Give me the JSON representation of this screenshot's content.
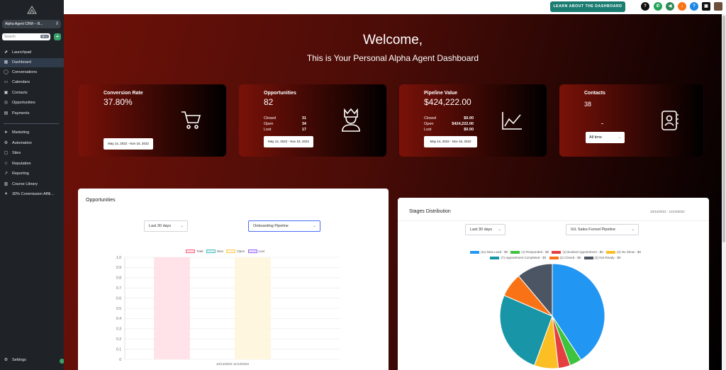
{
  "sidebar": {
    "account": "Alpha Agent CRM -- B...",
    "search_placeholder": "Search",
    "search_shortcut": "⌘ K",
    "add_label": "+",
    "items": [
      {
        "label": "Launchpad",
        "icon": "rocket-icon"
      },
      {
        "label": "Dashboard",
        "icon": "dashboard-icon"
      },
      {
        "label": "Conversations",
        "icon": "chat-icon"
      },
      {
        "label": "Calendars",
        "icon": "calendar-icon"
      },
      {
        "label": "Contacts",
        "icon": "contacts-icon"
      },
      {
        "label": "Opportunities",
        "icon": "opportunities-icon"
      },
      {
        "label": "Payments",
        "icon": "payments-icon"
      }
    ],
    "items2": [
      {
        "label": "Marketing",
        "icon": "send-icon"
      },
      {
        "label": "Automation",
        "icon": "automation-icon"
      },
      {
        "label": "Sites",
        "icon": "sites-icon"
      },
      {
        "label": "Reputation",
        "icon": "star-icon"
      },
      {
        "label": "Reporting",
        "icon": "chart-icon"
      },
      {
        "label": "Course Library",
        "icon": "book-icon"
      },
      {
        "label": "30% Commission Affili...",
        "icon": "gift-icon"
      }
    ],
    "settings": "Settings",
    "active": "Dashboard"
  },
  "topbar": {
    "learn_button": "LEARN ABOUT THE DASHBOARD",
    "icons": [
      "help-icon",
      "phone-icon",
      "megaphone-icon",
      "bell-icon",
      "question-icon",
      "contact-card-icon",
      "avatar"
    ]
  },
  "hero": {
    "title": "Welcome,",
    "subtitle": "This is Your Personal Alpha Agent Dashboard"
  },
  "cards": {
    "conversion": {
      "label": "Conversion Rate",
      "value": "37.80%",
      "date": "May 14, 2022 - Nov 15, 2022"
    },
    "opportunities": {
      "label": "Opportunities",
      "value": "82",
      "rows": [
        {
          "k": "Closed",
          "v": "31"
        },
        {
          "k": "Open",
          "v": "34"
        },
        {
          "k": "Lost",
          "v": "17"
        }
      ],
      "date": "May 14, 2022 - Nov 15, 2022"
    },
    "pipeline": {
      "label": "Pipeline Value",
      "value": "$424,222.00",
      "rows": [
        {
          "k": "Closed",
          "v": "$0.00"
        },
        {
          "k": "Open",
          "v": "$424,222.00"
        },
        {
          "k": "Lost",
          "v": "$0.00"
        }
      ],
      "date": "May 14, 2022 - Nov 15, 2022"
    },
    "contacts": {
      "label": "Contacts",
      "value": "38",
      "filter": "All time"
    }
  },
  "opportunities_panel": {
    "title": "Opportunities",
    "range": "Last 30 days",
    "pipeline": "Onboarding Pipeline",
    "chart_data": {
      "type": "bar",
      "categories": [
        "10/14/2022-11/13/2022"
      ],
      "series": [
        {
          "name": "Total",
          "values": [
            0
          ],
          "color": "#ff6384"
        },
        {
          "name": "Won",
          "values": [
            0
          ],
          "color": "#4bc0c0"
        },
        {
          "name": "Open",
          "values": [
            0
          ],
          "color": "#ffcd56"
        },
        {
          "name": "Lost",
          "values": [
            0
          ],
          "color": "#9966ff"
        }
      ],
      "ylim": [
        0,
        1.0
      ],
      "yticks": [
        "1.0",
        "0.9",
        "0.8",
        "0.7",
        "0.6",
        "0.5",
        "0.4",
        "0.3",
        "0.2",
        "0.1",
        "0"
      ],
      "legend": "top"
    }
  },
  "stages_panel": {
    "title": "Stages Distribution",
    "date_range": "10/13/2022 - 11/13/2022",
    "range": "Last 30 days",
    "pipeline": "IUL Sales Funnel Pipeline",
    "chart_data": {
      "type": "pie",
      "legend": "top",
      "slices": [
        {
          "label": "(11) New Lead - $0",
          "value": 11,
          "color": "#2196f3"
        },
        {
          "label": "(1) Responded - $0",
          "value": 1,
          "color": "#3ec33e"
        },
        {
          "label": "(1) Booked Appointment - $0",
          "value": 1,
          "color": "#e53e3e"
        },
        {
          "label": "(2) No Show - $0",
          "value": 2,
          "color": "#fbbf24"
        },
        {
          "label": "(7) Appointment Completed - $0",
          "value": 7,
          "color": "#1896a8"
        },
        {
          "label": "(2) Closed - $0",
          "value": 2,
          "color": "#f97316"
        },
        {
          "label": "(3) Not Ready - $0",
          "value": 3,
          "color": "#4b5563"
        }
      ]
    }
  }
}
